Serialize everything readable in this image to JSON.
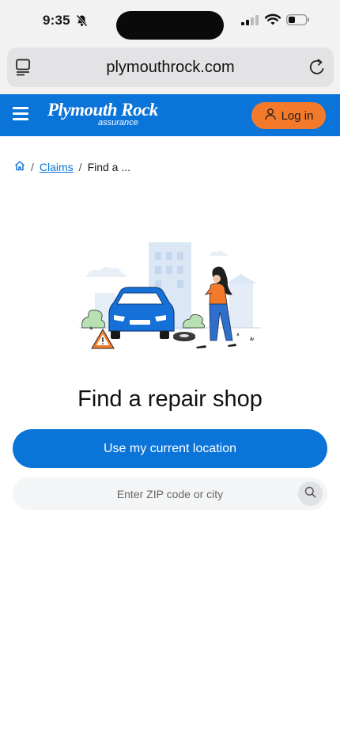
{
  "status_bar": {
    "time": "9:35"
  },
  "browser": {
    "url": "plymouthrock.com"
  },
  "header": {
    "logo_main": "Plymouth Rock",
    "logo_sub": "assurance",
    "login_label": "Log in",
    "colors": {
      "brand_blue": "#0a74d9",
      "login_orange": "#f47a2b"
    }
  },
  "breadcrumb": {
    "separator": "/",
    "claims_label": "Claims",
    "current_label": "Find a ..."
  },
  "main": {
    "title": "Find a repair shop",
    "locate_button_label": "Use my current location",
    "search_placeholder": "Enter ZIP code or city"
  },
  "icons": [
    "bell-slash-icon",
    "cellular-signal-icon",
    "wifi-icon",
    "battery-icon",
    "tabs-icon",
    "reload-icon",
    "hamburger-menu-icon",
    "user-icon",
    "home-icon",
    "search-icon"
  ]
}
